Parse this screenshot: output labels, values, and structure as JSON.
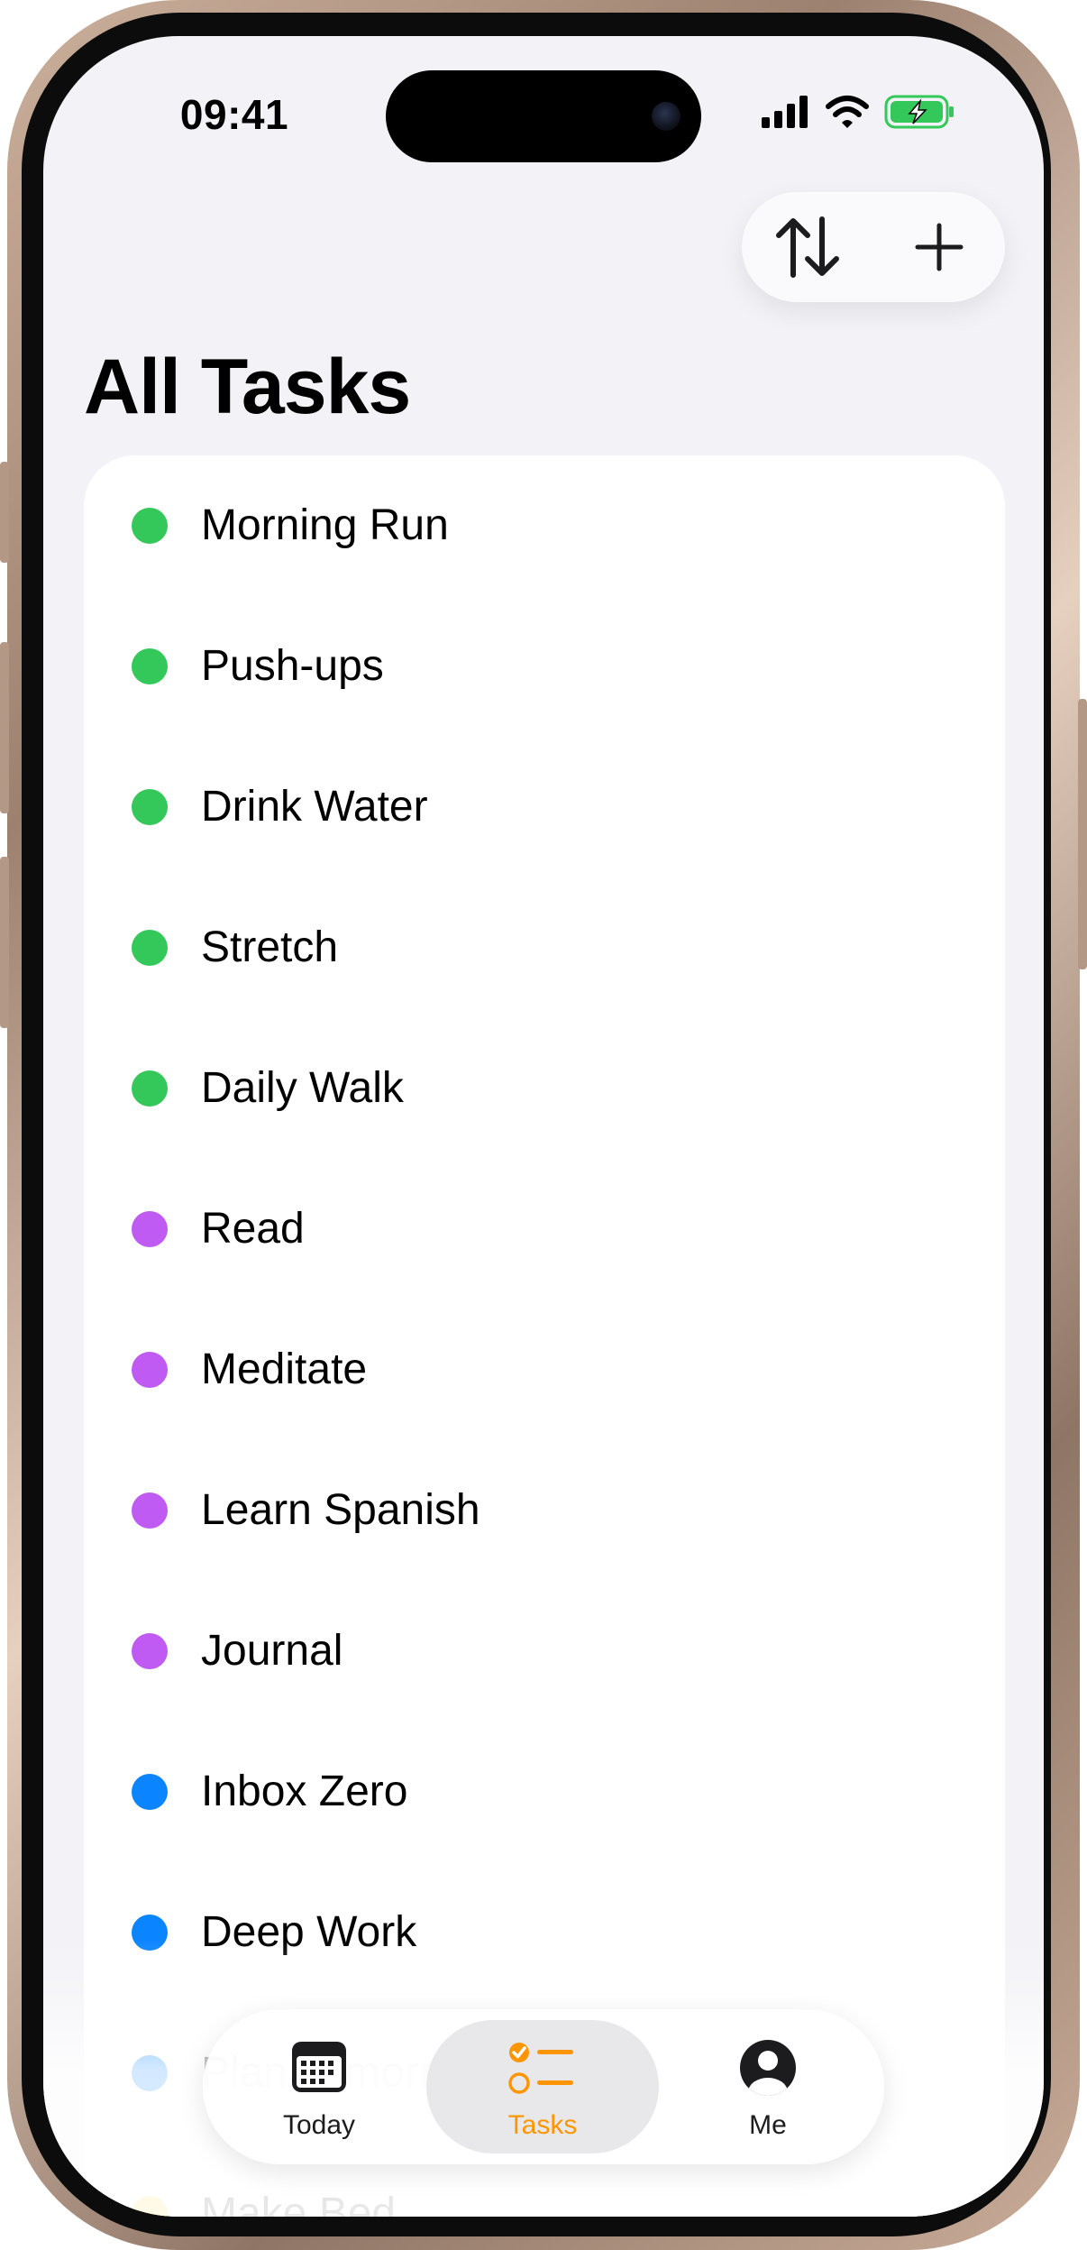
{
  "status_bar": {
    "time": "09:41"
  },
  "toolbar": {
    "sort_icon": "arrow-up-down-icon",
    "add_icon": "plus-icon"
  },
  "page": {
    "title": "All Tasks"
  },
  "tasks": [
    {
      "label": "Morning Run",
      "color": "#34c759"
    },
    {
      "label": "Push-ups",
      "color": "#34c759"
    },
    {
      "label": "Drink Water",
      "color": "#34c759"
    },
    {
      "label": "Stretch",
      "color": "#34c759"
    },
    {
      "label": "Daily Walk",
      "color": "#34c759"
    },
    {
      "label": "Read",
      "color": "#bf5af2"
    },
    {
      "label": "Meditate",
      "color": "#bf5af2"
    },
    {
      "label": "Learn Spanish",
      "color": "#bf5af2"
    },
    {
      "label": "Journal",
      "color": "#bf5af2"
    },
    {
      "label": "Inbox Zero",
      "color": "#0a84ff"
    },
    {
      "label": "Deep Work",
      "color": "#0a84ff"
    },
    {
      "label": "Plan Tomorrow",
      "color": "#0a84ff"
    },
    {
      "label": "Make Bed",
      "color": "#ffcc00"
    }
  ],
  "tab_bar": {
    "items": [
      {
        "label": "Today",
        "icon": "calendar-icon"
      },
      {
        "label": "Tasks",
        "icon": "checklist-icon",
        "active": true
      },
      {
        "label": "Me",
        "icon": "person-circle-icon"
      }
    ],
    "active_color": "#ff9500"
  }
}
